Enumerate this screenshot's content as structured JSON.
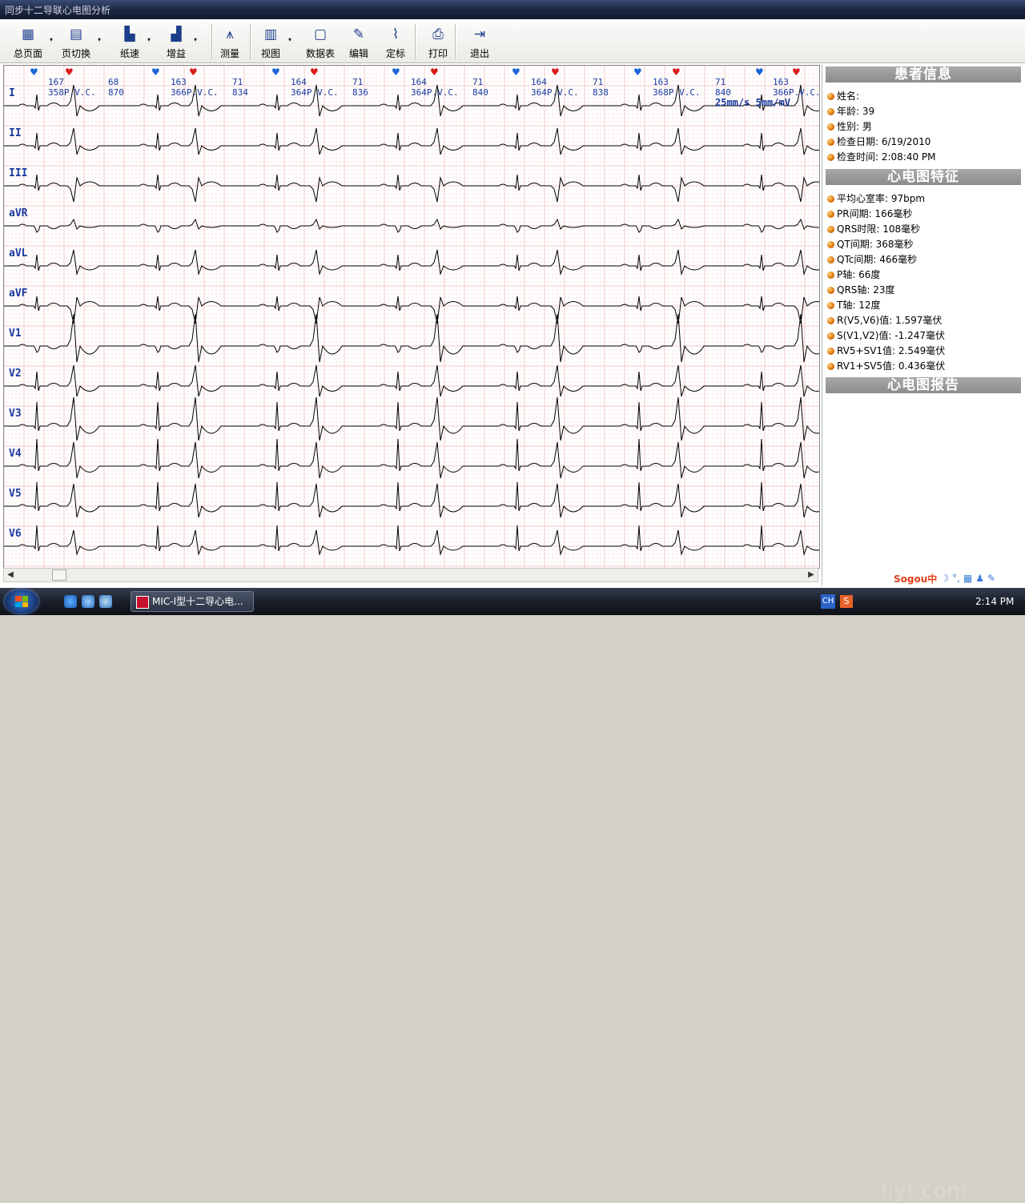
{
  "window": {
    "title": "同步十二导联心电图分析"
  },
  "toolbar": [
    {
      "label": "总页面",
      "icon": "total-page-icon",
      "dropdown": true
    },
    {
      "label": "页切换",
      "icon": "page-switch-icon",
      "dropdown": true
    },
    {
      "label": "纸速",
      "icon": "paper-speed-icon",
      "dropdown": true
    },
    {
      "label": "增益",
      "icon": "gain-icon",
      "dropdown": true
    },
    {
      "label": "测量",
      "icon": "measure-compass-icon",
      "dropdown": false
    },
    {
      "label": "视图",
      "icon": "view-icon",
      "dropdown": true
    },
    {
      "label": "数据表",
      "icon": "data-table-icon",
      "dropdown": false
    },
    {
      "label": "编辑",
      "icon": "edit-pencil-icon",
      "dropdown": false
    },
    {
      "label": "定标",
      "icon": "calibrate-icon",
      "dropdown": false
    },
    {
      "label": "打印",
      "icon": "printer-icon",
      "dropdown": false
    },
    {
      "label": "退出",
      "icon": "exit-door-icon",
      "dropdown": false
    }
  ],
  "ecg": {
    "scale_text": "25mm/s  5mm/mV",
    "leads": [
      "I",
      "II",
      "III",
      "aVR",
      "aVL",
      "aVF",
      "V1",
      "V2",
      "V3",
      "V4",
      "V5",
      "V6"
    ],
    "markers": [
      "blue",
      "red",
      "blue",
      "red",
      "blue",
      "red",
      "blue",
      "red",
      "blue",
      "red",
      "blue",
      "red",
      "blue",
      "red"
    ],
    "beat_annotations": [
      {
        "top": "167",
        "bottom": "358P.V.C."
      },
      {
        "top": "68",
        "bottom": "870"
      },
      {
        "top": "163",
        "bottom": "366P.V.C."
      },
      {
        "top": "71",
        "bottom": "834"
      },
      {
        "top": "164",
        "bottom": "364P.V.C."
      },
      {
        "top": "71",
        "bottom": "836"
      },
      {
        "top": "164",
        "bottom": "364P.V.C."
      },
      {
        "top": "71",
        "bottom": "840"
      },
      {
        "top": "164",
        "bottom": "364P.V.C."
      },
      {
        "top": "71",
        "bottom": "838"
      },
      {
        "top": "163",
        "bottom": "368P.V.C."
      },
      {
        "top": "71",
        "bottom": "840"
      },
      {
        "top": "163",
        "bottom": "366P.V.C."
      }
    ],
    "grid_color": "#f0bcbc",
    "trace_color": "#000000"
  },
  "patient_info": {
    "heading": "患者信息",
    "rows": [
      "姓名:",
      "年龄: 39",
      "性别: 男",
      "检查日期: 6/19/2010",
      "检查时间: 2:08:40 PM"
    ]
  },
  "ecg_features": {
    "heading": "心电图特征",
    "rows": [
      "平均心室率: 97bpm",
      "PR间期: 166毫秒",
      "QRS时限: 108毫秒",
      "QT间期: 368毫秒",
      "QTc间期: 466毫秒",
      "P轴: 66度",
      "QRS轴: 23度",
      "T轴: 12度",
      "R(V5,V6)值: 1.597毫伏",
      "S(V1,V2)值: -1.247毫伏",
      "RV5+SV1值: 2.549毫伏",
      "RV1+SV5值: 0.436毫伏"
    ]
  },
  "ecg_report": {
    "heading": "心电图报告"
  },
  "taskbar": {
    "task_label": "MIC-I型十二导心电...",
    "ime": "CH",
    "clock": "2:14 PM",
    "watermark": "liyi.com"
  },
  "sogou": {
    "label": "Sogou中"
  }
}
